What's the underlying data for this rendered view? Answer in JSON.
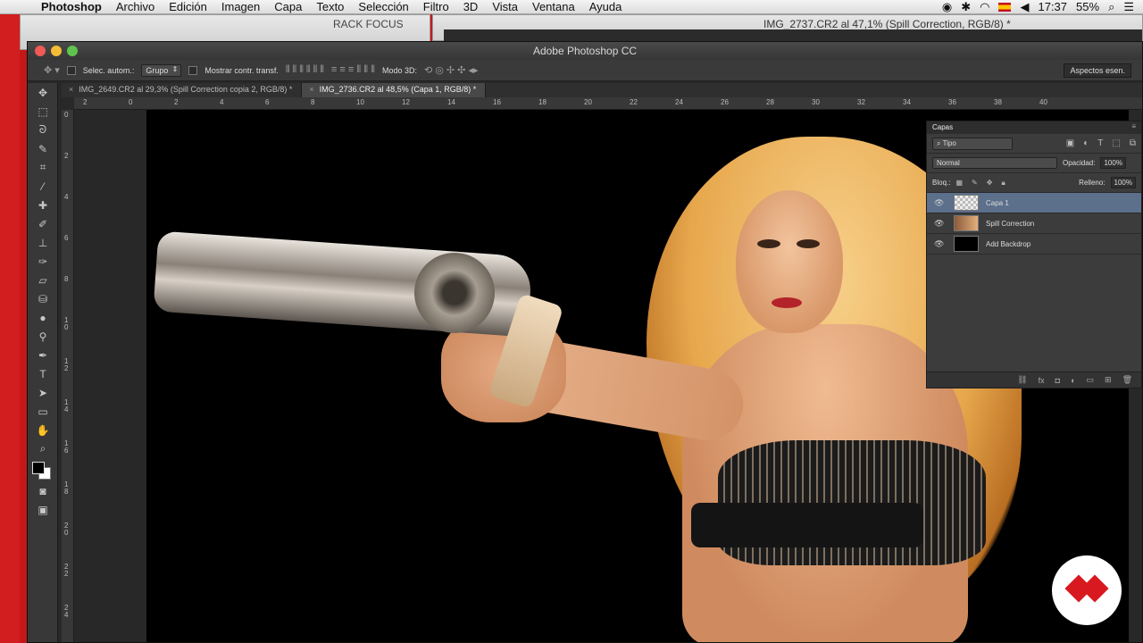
{
  "menubar": {
    "app": "Photoshop",
    "items": [
      "Archivo",
      "Edición",
      "Imagen",
      "Capa",
      "Texto",
      "Selección",
      "Filtro",
      "3D",
      "Vista",
      "Ventana",
      "Ayuda"
    ],
    "time": "17:37",
    "battery": "55%"
  },
  "bg_windows": {
    "folder_title": "RACK FOCUS",
    "doc_title": "IMG_2737.CR2 al 47,1% (Spill Correction, RGB/8) *"
  },
  "window": {
    "title": "Adobe Photoshop CC"
  },
  "options": {
    "auto_select_label": "Selec. autom.:",
    "auto_select_value": "Grupo",
    "show_transform_label": "Mostrar contr. transf.",
    "mode3d_label": "Modo 3D:",
    "workspace": "Aspectos esen."
  },
  "tabs": [
    {
      "label": "IMG_2649.CR2 al 29,3% (Spill Correction copia 2, RGB/8) *"
    },
    {
      "label": "IMG_2736.CR2 al 48,5% (Capa 1, RGB/8) *"
    }
  ],
  "ruler_h": [
    "2",
    "0",
    "2",
    "4",
    "6",
    "8",
    "10",
    "12",
    "14",
    "16",
    "18",
    "20",
    "22",
    "24",
    "26",
    "28",
    "30",
    "32",
    "34",
    "36",
    "38",
    "40"
  ],
  "ruler_v": [
    "0",
    "2",
    "4",
    "6",
    "8",
    "1 0",
    "1 2",
    "1 4",
    "1 6",
    "1 8",
    "2 0",
    "2 2",
    "2 4"
  ],
  "layers_panel": {
    "title": "Capas",
    "filter": "Tipo",
    "blend_mode": "Normal",
    "opacity_label": "Opacidad:",
    "opacity": "100%",
    "lock_label": "Bloq.:",
    "fill_label": "Relleno:",
    "fill": "100%",
    "layers": [
      {
        "name": "Capa 1"
      },
      {
        "name": "Spill Correction"
      },
      {
        "name": "Add Backdrop"
      }
    ]
  }
}
